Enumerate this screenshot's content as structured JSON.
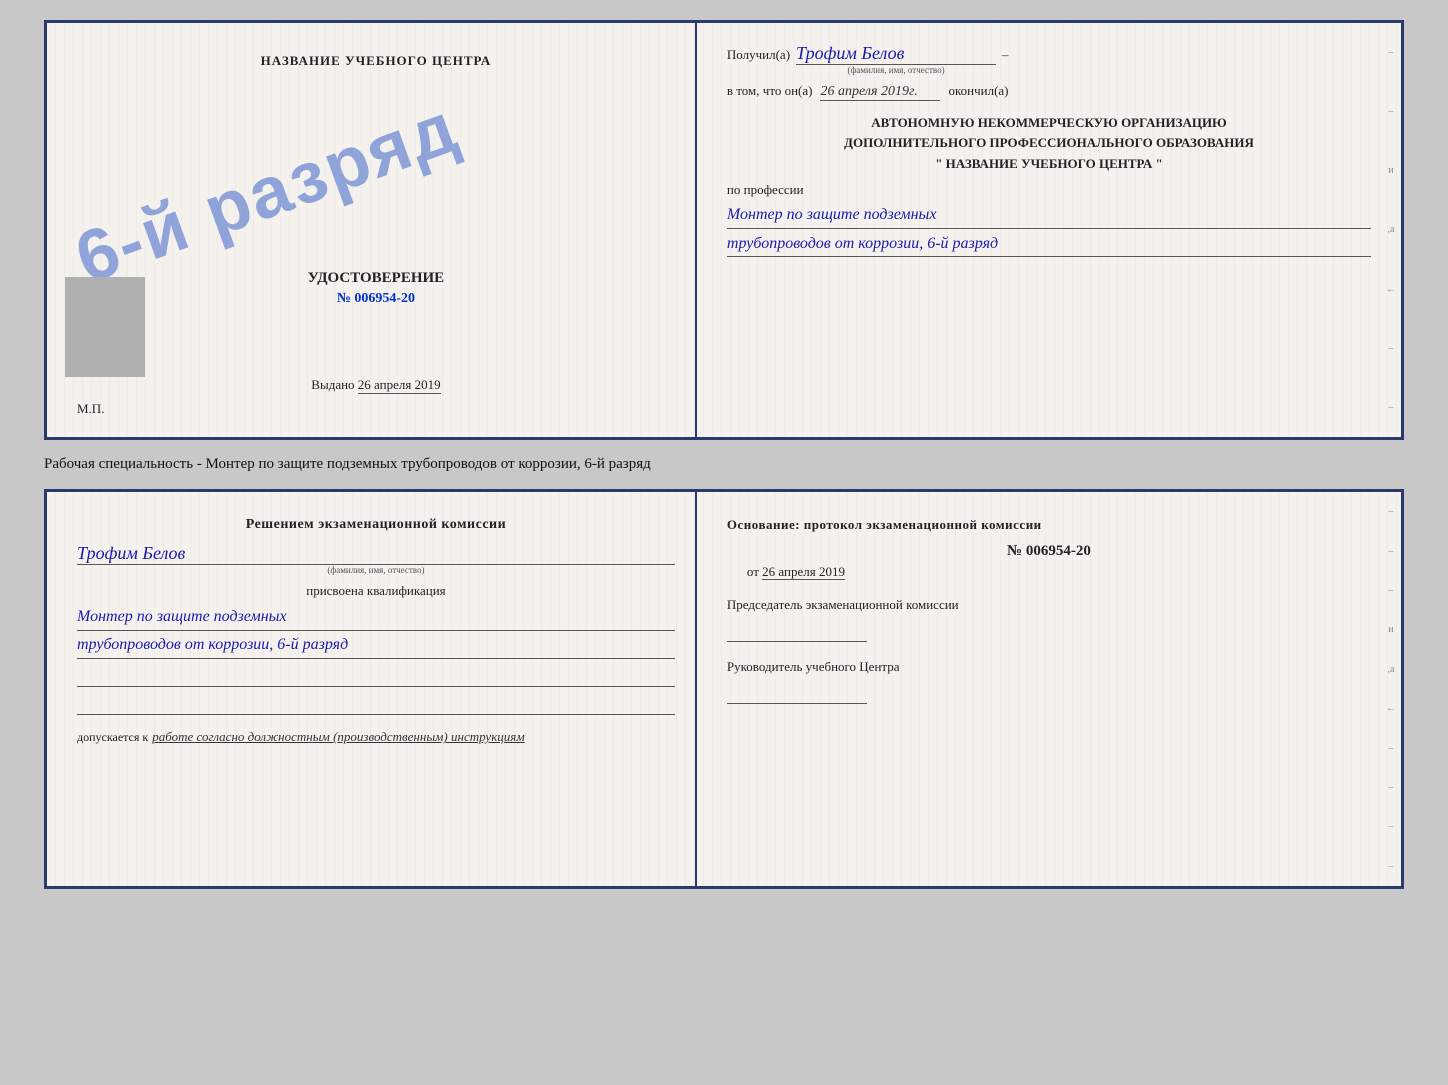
{
  "top_cert": {
    "left": {
      "school_name": "НАЗВАНИЕ УЧЕБНОГО ЦЕНТРА",
      "stamp_text": "6-й разряд",
      "udost_label": "УДОСТОВЕРЕНИЕ",
      "udost_num": "№ 006954-20",
      "issued_label": "Выдано",
      "issued_date": "26 апреля 2019",
      "mp_label": "М.П."
    },
    "right": {
      "received_label": "Получил(а)",
      "recipient_name": "Трофим Белов",
      "fio_hint": "(фамилия, имя, отчество)",
      "in_that_label": "в том, что он(а)",
      "date_handwritten": "26 апреля 2019г.",
      "finished_label": "окончил(а)",
      "org_line1": "АВТОНОМНУЮ НЕКОММЕРЧЕСКУЮ ОРГАНИЗАЦИЮ",
      "org_line2": "ДОПОЛНИТЕЛЬНОГО ПРОФЕССИОНАЛЬНОГО ОБРАЗОВАНИЯ",
      "school_quoted": "\"  НАЗВАНИЕ УЧЕБНОГО ЦЕНТРА  \"",
      "profession_label": "по профессии",
      "profession_line1": "Монтер по защите подземных",
      "profession_line2": "трубопроводов от коррозии, 6-й разряд"
    }
  },
  "middle_label": {
    "text": "Рабочая специальность - Монтер по защите подземных трубопроводов от коррозии, 6-й разряд"
  },
  "bottom_cert": {
    "left": {
      "header": "Решением экзаменационной комиссии",
      "person_name": "Трофим Белов",
      "fio_hint": "(фамилия, имя, отчество)",
      "assigned_label": "присвоена квалификация",
      "kvalif_line1": "Монтер по защите подземных",
      "kvalif_line2": "трубопроводов от коррозии, 6-й разряд",
      "dopusk_label": "допускается к",
      "dopusk_text": "работе согласно должностным (производственным) инструкциям"
    },
    "right": {
      "osnov_text": "Основание: протокол экзаменационной комиссии",
      "protocol_num": "№ 006954-20",
      "from_label": "от",
      "from_date": "26 апреля 2019",
      "chairman_label": "Председатель экзаменационной комиссии",
      "manager_label": "Руководитель учебного Центра"
    }
  }
}
